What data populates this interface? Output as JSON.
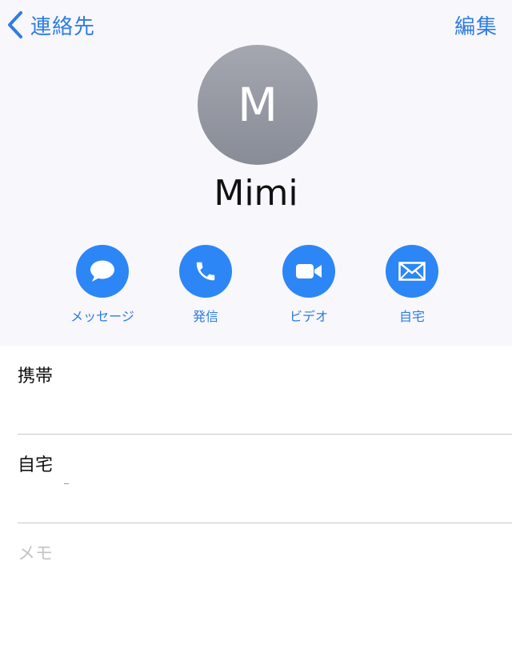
{
  "nav": {
    "back_label": "連絡先",
    "back_icon": "chevron-left-icon",
    "edit_label": "編集"
  },
  "contact": {
    "initial": "M",
    "name": "Mimi"
  },
  "actions": [
    {
      "label": "メッセージ",
      "icon": "message-bubble-icon"
    },
    {
      "label": "発信",
      "icon": "phone-icon"
    },
    {
      "label": "ビデオ",
      "icon": "video-camera-icon"
    },
    {
      "label": "自宅",
      "icon": "mail-envelope-icon"
    }
  ],
  "fields": [
    {
      "label": "携帯"
    },
    {
      "label": "自宅"
    }
  ],
  "memo": {
    "placeholder": "メモ"
  },
  "colors": {
    "accent": "#2f7de1",
    "action_circle": "#2d86f5",
    "header_bg": "#f7f7fc",
    "avatar_bg": "#9a9da6",
    "divider": "#c9c9cd",
    "memo_placeholder": "#c4c4c8"
  }
}
